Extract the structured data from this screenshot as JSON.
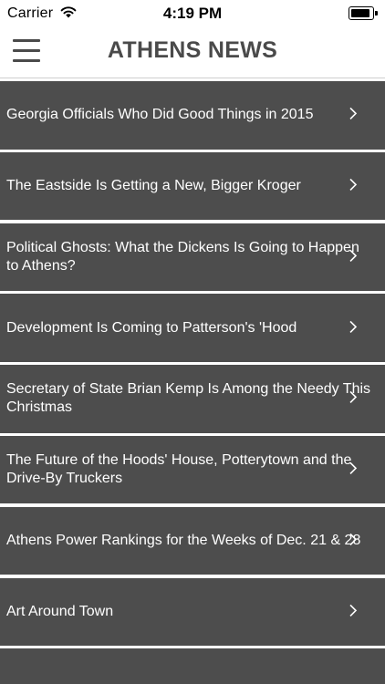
{
  "status_bar": {
    "carrier": "Carrier",
    "time": "4:19 PM",
    "battery_level": 0.9
  },
  "nav": {
    "title": "ATHENS NEWS"
  },
  "articles": [
    {
      "title": "Georgia Officials Who Did Good Things in 2015"
    },
    {
      "title": "The Eastside Is Getting a New, Bigger Kroger"
    },
    {
      "title": "Political Ghosts: What the Dickens Is Going to Happen to Athens?"
    },
    {
      "title": "Development Is Coming to Patterson's 'Hood"
    },
    {
      "title": "Secretary of State Brian Kemp Is Among the Needy This Christmas"
    },
    {
      "title": "The Future of the Hoods' House, Potterytown and the Drive-By Truckers"
    },
    {
      "title": "Athens Power Rankings for the Weeks of Dec. 21 & 28"
    },
    {
      "title": "Art Around Town"
    },
    {
      "title": ""
    }
  ],
  "colors": {
    "item_background": "#4d4d4d",
    "item_text": "#ffffff",
    "title_text": "#4a4a4a"
  },
  "icons": {
    "menu": "hamburger-menu-icon",
    "chevron": "chevron-right-icon",
    "wifi": "wifi-icon",
    "battery": "battery-icon"
  }
}
